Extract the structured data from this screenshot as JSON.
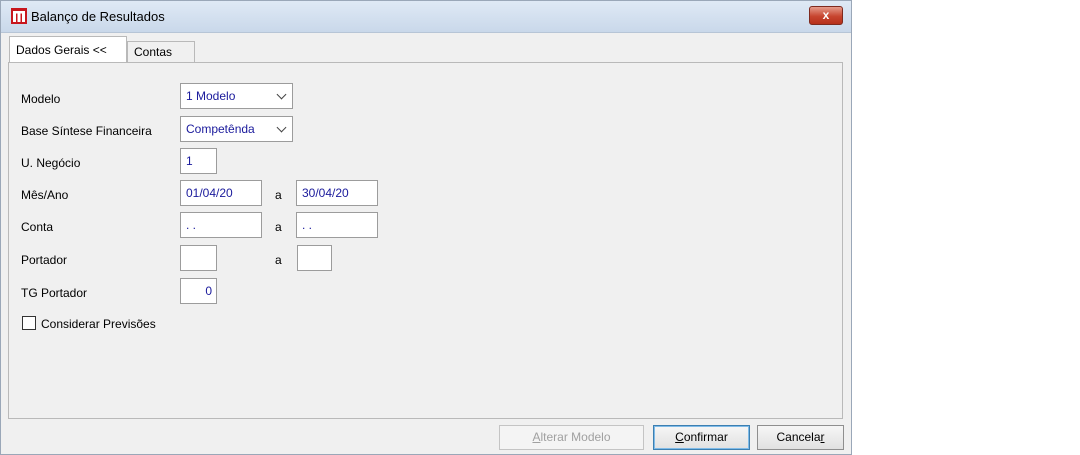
{
  "window": {
    "title": "Balanço de Resultados",
    "close_label": "x",
    "colors": {
      "close": "#c7452f",
      "titlebar": "#dfe9f5",
      "field_text": "#1a1a9c"
    }
  },
  "tabs": [
    {
      "label": "Dados Gerais <<",
      "active": true
    },
    {
      "label": "Contas",
      "active": false
    }
  ],
  "form": {
    "modelo": {
      "label": "Modelo",
      "value": "1 Modelo"
    },
    "base": {
      "label": "Base Síntese Financeira",
      "value": "Competênda"
    },
    "unegocio": {
      "label": "U. Negócio",
      "value": "1"
    },
    "mesano": {
      "label": "Mês/Ano",
      "from": "01/04/20",
      "sep": "a",
      "to": "30/04/20"
    },
    "conta": {
      "label": "Conta",
      "from": ". .",
      "sep": "a",
      "to": ". ."
    },
    "portador": {
      "label": "Portador",
      "from": "",
      "sep": "a",
      "to": ""
    },
    "tgportador": {
      "label": "TG Portador",
      "value": "0"
    },
    "previsoes": {
      "label": "Considerar Previsões",
      "checked": false
    }
  },
  "buttons": {
    "alterar": {
      "mn": "A",
      "rest": "lterar Modelo"
    },
    "confirmar": {
      "mn": "C",
      "rest": "onfirmar"
    },
    "cancelar": {
      "pre": "Cancela",
      "mn": "r"
    }
  }
}
